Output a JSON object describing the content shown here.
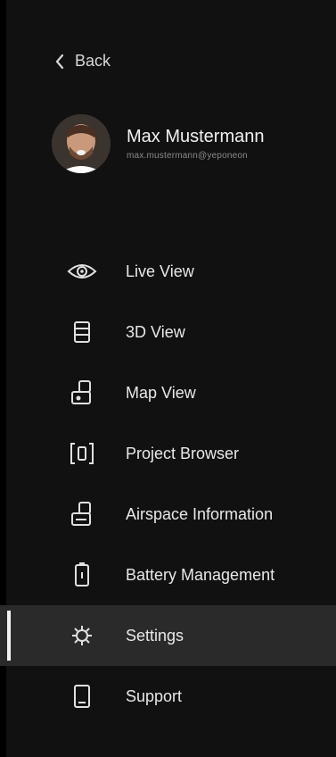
{
  "back": {
    "label": "Back",
    "icon": "chevron-left-icon"
  },
  "profile": {
    "name": "Max Mustermann",
    "email": "max.mustermann@yeponeon"
  },
  "menu": {
    "items": [
      {
        "label": "Live View",
        "icon": "eye-icon"
      },
      {
        "label": "3D View",
        "icon": "cube-icon"
      },
      {
        "label": "Map View",
        "icon": "map-icon"
      },
      {
        "label": "Project Browser",
        "icon": "project-browser-icon"
      },
      {
        "label": "Airspace Information",
        "icon": "airspace-icon"
      },
      {
        "label": "Battery Management",
        "icon": "battery-icon"
      },
      {
        "label": "Settings",
        "icon": "gear-icon"
      },
      {
        "label": "Support",
        "icon": "support-icon"
      }
    ],
    "active_item": "Settings"
  },
  "colors": {
    "background": "#111111",
    "active_row": "#2a2a2a",
    "text": "#e8e8e8",
    "muted_text": "#8a8a8a"
  }
}
